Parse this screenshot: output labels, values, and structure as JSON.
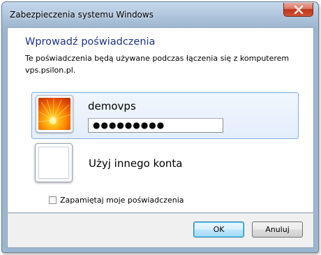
{
  "window": {
    "title": "Zabezpieczenia systemu Windows"
  },
  "dialog": {
    "heading": "Wprowadź poświadczenia",
    "description": "Te poświadczenia będą używane podczas łączenia się z komputerem vps.psilon.pl."
  },
  "account": {
    "username": "demovps",
    "password_mask": "●●●●●●●●●"
  },
  "other_account": {
    "label": "Użyj innego konta"
  },
  "remember": {
    "label": "Zapamiętaj moje poświadczenia",
    "checked": false
  },
  "buttons": {
    "ok": "OK",
    "cancel": "Anuluj"
  },
  "colors": {
    "heading": "#1e3287",
    "close_button": "#c0341a",
    "selected_tile": "#e3eefb"
  },
  "icons": {
    "close": "close-icon",
    "user_picture": "user-picture-flower",
    "other_account_picture": "blank-user-picture"
  }
}
